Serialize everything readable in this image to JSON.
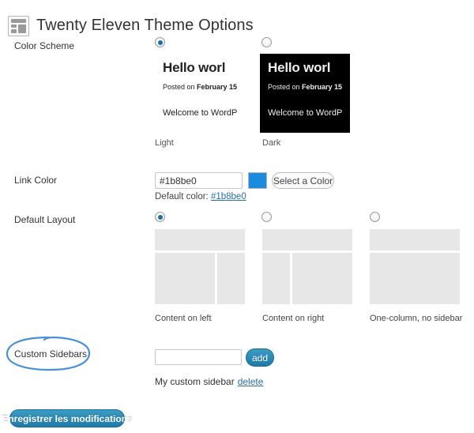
{
  "header": {
    "icon": "appearance-layout-icon",
    "title": "Twenty Eleven Theme Options"
  },
  "color_scheme": {
    "label": "Color Scheme",
    "options": [
      {
        "value": "light",
        "caption": "Light",
        "selected": true,
        "preview": {
          "title": "Hello worl",
          "meta_prefix": "Posted on ",
          "meta_date": "February 15",
          "body": "Welcome to WordP"
        }
      },
      {
        "value": "dark",
        "caption": "Dark",
        "selected": false,
        "preview": {
          "title": "Hello worl",
          "meta_prefix": "Posted on ",
          "meta_date": "February 15",
          "body": "Welcome to WordP"
        }
      }
    ]
  },
  "link_color": {
    "label": "Link Color",
    "value": "#1b8be0",
    "placeholder": "",
    "swatch_color": "#1b8be0",
    "select_button": "Select a Color",
    "default_prefix": "Default color: ",
    "default_value": "#1b8be0"
  },
  "default_layout": {
    "label": "Default Layout",
    "options": [
      {
        "value": "content-sidebar",
        "caption": "Content on left",
        "selected": true
      },
      {
        "value": "sidebar-content",
        "caption": "Content on right",
        "selected": false
      },
      {
        "value": "content",
        "caption": "One-column, no sidebar",
        "selected": false
      }
    ]
  },
  "custom_sidebars": {
    "label": "Custom Sidebars",
    "input_value": "",
    "input_placeholder": "",
    "add_button": "add",
    "existing": [
      {
        "name": "My custom sidebar",
        "delete_label": "delete"
      }
    ]
  },
  "submit": {
    "label": "Enregistrer les modifications"
  },
  "annotation": {
    "shape": "hand-drawn-ellipse",
    "color": "#4a90d9",
    "target": "Custom Sidebars"
  }
}
